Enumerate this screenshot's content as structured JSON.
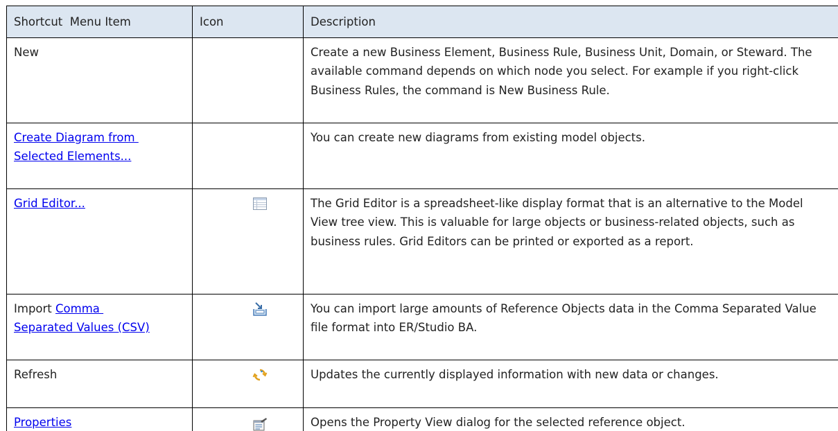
{
  "table": {
    "headers": {
      "item": "Shortcut  Menu Item",
      "icon": "Icon",
      "description": "Description"
    },
    "rows": [
      {
        "item_text": "New",
        "icon": "none",
        "description": "Create a new Business Element, Business Rule, Business Unit, Domain, or Steward. The available command depends on which node you select. For example if you right-click Business Rules, the command is New Business Rule."
      },
      {
        "item_link_line1": "Create Diagram from ",
        "item_link_line2": "Selected Elements...",
        "icon": "none",
        "description": "You can create new diagrams from existing model objects."
      },
      {
        "item_link": "Grid Editor...",
        "icon": "grid-editor-icon",
        "description": "The Grid Editor is a spreadsheet-like display format that is an alternative to the Model View tree view. This is valuable for large objects or business-related objects, such as business rules. Grid Editors can be printed or exported as a report."
      },
      {
        "item_prefix": "Import ",
        "item_link_line1": "Comma ",
        "item_link_line2": "Separated Values (CSV)",
        "icon": "import-csv-icon",
        "description": "You can import large amounts of Reference Objects data in the Comma Separated Value file format into ER/Studio BA."
      },
      {
        "item_text": "Refresh",
        "icon": "refresh-icon",
        "description": "Updates the currently displayed information with new data or changes."
      },
      {
        "item_link": "Properties",
        "icon": "properties-icon",
        "description": "Opens the Property View dialog for the selected reference object."
      }
    ]
  },
  "colors": {
    "header_bg": "#dce6f1",
    "link": "#0000ee",
    "border": "#000000"
  }
}
